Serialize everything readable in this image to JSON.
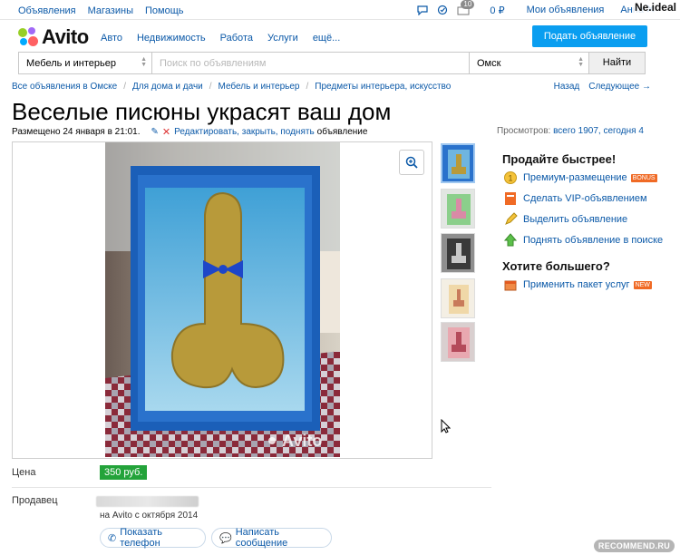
{
  "topbar": {
    "links": [
      "Объявления",
      "Магазины",
      "Помощь"
    ],
    "notifications_count": "10",
    "balance": "0 ₽",
    "my_ads": "Мои объявления",
    "user_name": "Анна",
    "user_overlay": "Ne.ideal"
  },
  "header": {
    "logo_text": "Avito",
    "nav": [
      "Авто",
      "Недвижимость",
      "Работа",
      "Услуги",
      "ещё..."
    ],
    "post_button": "Подать объявление"
  },
  "search": {
    "category": "Мебель и интерьер",
    "placeholder": "Поиск по объявлениям",
    "city": "Омск",
    "button": "Найти"
  },
  "breadcrumbs": [
    "Все объявления в Омске",
    "Для дома и дачи",
    "Мебель и интерьер",
    "Предметы интерьера, искусство"
  ],
  "nav_links": {
    "back": "Назад",
    "next": "Следующее →"
  },
  "ad": {
    "title": "Веселые писюны украсят ваш дом",
    "posted": "Размещено 24 января в 21:01.",
    "edit_links": "Редактировать, закрыть, поднять",
    "edit_suffix": "объявление",
    "views_label": "Просмотров:",
    "views_value": "всего 1907, сегодня 4",
    "price_label": "Цена",
    "price": "350 руб.",
    "seller_label": "Продавец",
    "seller_since": "на Avito с октября 2014",
    "show_phone": "Показать телефон",
    "write_message": "Написать сообщение",
    "photo_watermark": "Avito"
  },
  "sidebar": {
    "sell_faster": "Продайте быстрее!",
    "items": [
      {
        "label": "Премиум-размещение",
        "tag": "BONUS"
      },
      {
        "label": "Сделать VIP-объявлением",
        "tag": ""
      },
      {
        "label": "Выделить объявление",
        "tag": ""
      },
      {
        "label": "Поднять объявление в поиске",
        "tag": ""
      }
    ],
    "want_more": "Хотите большего?",
    "package": {
      "label": "Применить пакет услуг",
      "tag": "NEW"
    }
  },
  "watermark": "RECOMMEND.RU",
  "colors": {
    "link": "#0b59a8",
    "post_button": "#0a9ef0",
    "price_badge": "#23a33a",
    "tag": "#f06a25"
  },
  "icons": [
    "chat-icon",
    "favorites-icon",
    "notifications-icon",
    "close-icon",
    "edit-pencil-icon",
    "zoom-icon",
    "phone-icon",
    "message-icon"
  ]
}
